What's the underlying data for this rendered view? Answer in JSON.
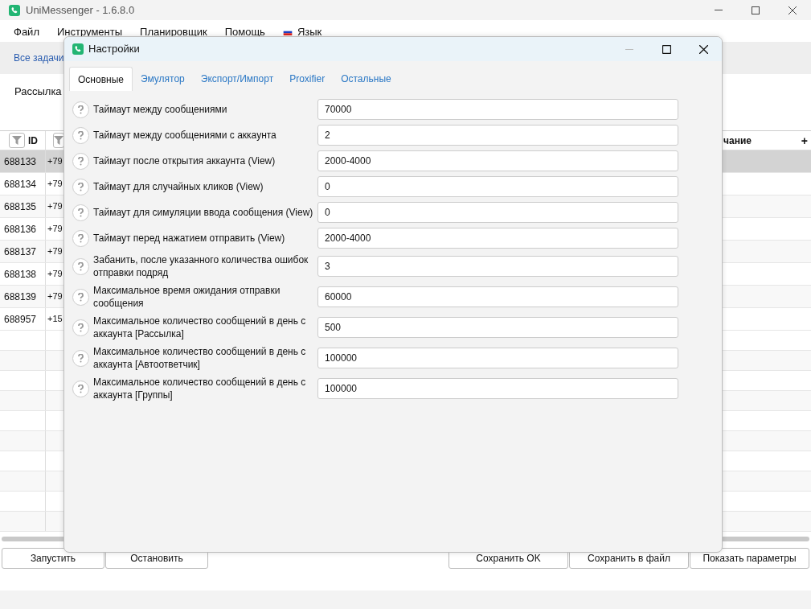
{
  "window": {
    "title": "UniMessenger - 1.6.8.0"
  },
  "menu": [
    {
      "label": "Файл",
      "kind": "text"
    },
    {
      "label": "Инструменты",
      "kind": "text"
    },
    {
      "label": "Планировщик",
      "kind": "text"
    },
    {
      "label": "Помощь",
      "kind": "text"
    },
    {
      "label": "Язык",
      "kind": "flag"
    }
  ],
  "toolbar": {
    "link": "Все задачи"
  },
  "section_title": "Рассылка",
  "table": {
    "columns": [
      {
        "label": "ID"
      },
      {
        "label": "чание"
      }
    ],
    "add_symbol": "+",
    "rows": [
      {
        "id": "688133",
        "phone": "+79",
        "selected": true
      },
      {
        "id": "688134",
        "phone": "+79",
        "selected": false
      },
      {
        "id": "688135",
        "phone": "+79",
        "selected": false
      },
      {
        "id": "688136",
        "phone": "+79",
        "selected": false
      },
      {
        "id": "688137",
        "phone": "+79",
        "selected": false
      },
      {
        "id": "688138",
        "phone": "+79",
        "selected": false
      },
      {
        "id": "688139",
        "phone": "+79",
        "selected": false
      },
      {
        "id": "688957",
        "phone": "+15",
        "selected": false
      }
    ]
  },
  "buttons": [
    "Запустить",
    "Остановить",
    "Сохранить OK",
    "Сохранить в файл",
    "Показать параметры"
  ],
  "dialog": {
    "title": "Настройки",
    "tabs": [
      {
        "label": "Основные",
        "selected": true
      },
      {
        "label": "Эмулятор",
        "selected": false
      },
      {
        "label": "Экспорт/Импорт",
        "selected": false
      },
      {
        "label": "Proxifier",
        "selected": false
      },
      {
        "label": "Остальные",
        "selected": false
      }
    ],
    "fields": [
      {
        "label": "Таймаут между сообщениями",
        "value": "70000"
      },
      {
        "label": "Таймаут между сообщениями с аккаунта",
        "value": "2"
      },
      {
        "label": "Таймаут после открытия аккаунта (View)",
        "value": "2000-4000"
      },
      {
        "label": "Таймаут для случайных кликов (View)",
        "value": "0"
      },
      {
        "label": "Таймаут для симуляции ввода сообщения (View)",
        "value": "0"
      },
      {
        "label": "Таймаут перед нажатием отправить (View)",
        "value": "2000-4000"
      },
      {
        "label": "Забанить, после указанного количества ошибок отправки подряд",
        "value": "3"
      },
      {
        "label": "Максимальное время ожидания отправки сообщения",
        "value": "60000"
      },
      {
        "label": "Максимальное количество сообщений в день с аккаунта [Рассылка]",
        "value": "500"
      },
      {
        "label": "Максимальное количество сообщений в день с аккаунта [Автоответчик]",
        "value": "100000"
      },
      {
        "label": "Максимальное количество сообщений в день с аккаунта [Группы]",
        "value": "100000"
      }
    ]
  }
}
